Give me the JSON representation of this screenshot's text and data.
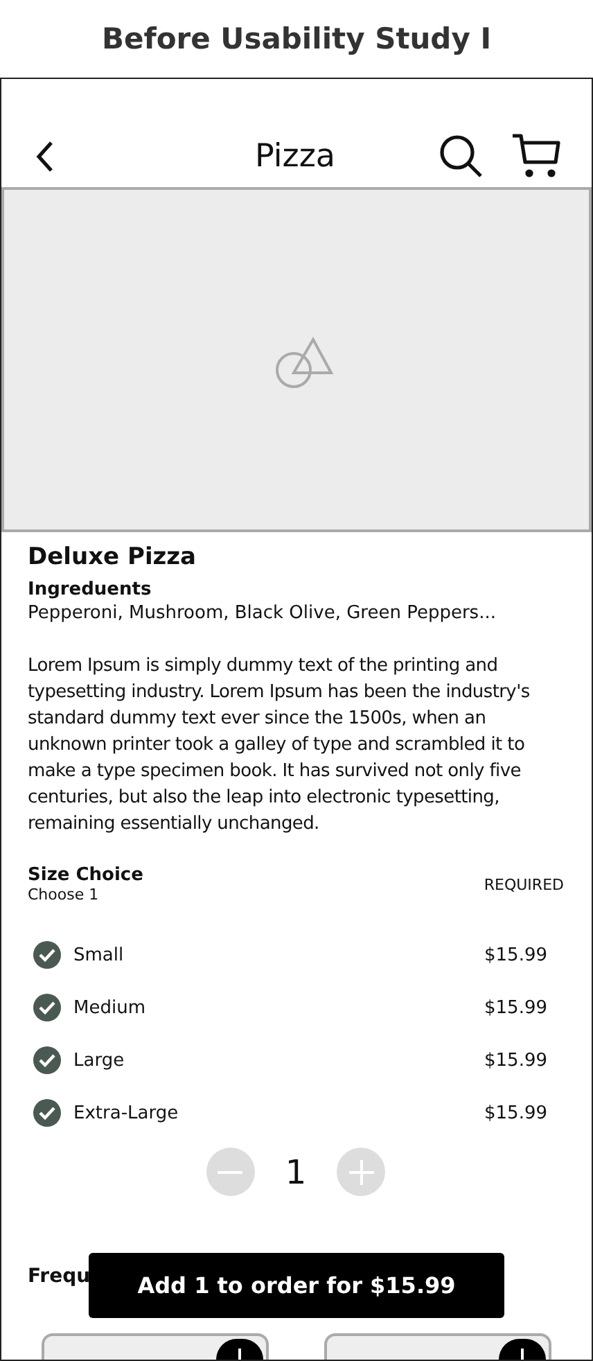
{
  "page_title": "Before Usability Study I",
  "header": {
    "title": "Pizza"
  },
  "product": {
    "name": "Deluxe Pizza",
    "ingredients_label": "Ingreduents",
    "ingredients": "Pepperoni, Mushroom, Black Olive, Green Peppers...",
    "description": "Lorem Ipsum is simply dummy text of the printing and typesetting industry. Lorem Ipsum has been the industry's standard dummy text ever since the 1500s, when an unknown printer took a galley of type and scrambled it to make a type specimen book. It has survived not only five centuries, but also the leap into electronic typesetting, remaining essentially unchanged."
  },
  "size_choice": {
    "title": "Size Choice",
    "subtitle": "Choose 1",
    "badge": "REQUIRED",
    "options": [
      {
        "label": "Small",
        "price": "$15.99",
        "checked": true
      },
      {
        "label": "Medium",
        "price": "$15.99",
        "checked": true
      },
      {
        "label": "Large",
        "price": "$15.99",
        "checked": true
      },
      {
        "label": "Extra-Large",
        "price": "$15.99",
        "checked": true
      }
    ]
  },
  "quantity": "1",
  "section_heading": "Frequ",
  "add_button": "Add 1 to order for $15.99",
  "cards": [
    {
      "kind": "card"
    },
    {
      "kind": "card"
    }
  ]
}
